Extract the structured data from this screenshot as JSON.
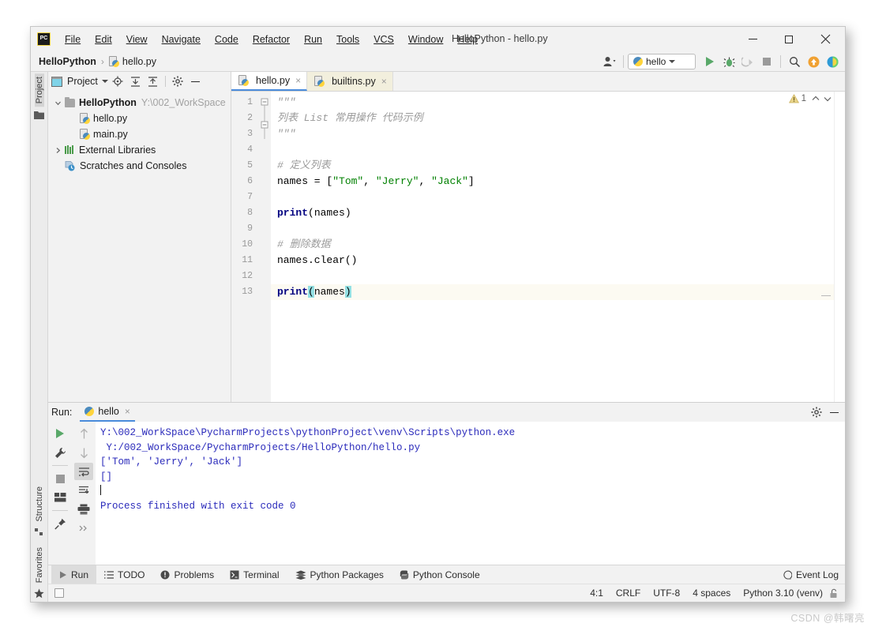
{
  "window": {
    "title": "HelloPython - hello.py",
    "logo_text": "PC",
    "min_label": "minimize",
    "max_label": "maximize",
    "close_label": "×"
  },
  "menubar": {
    "items": [
      "File",
      "Edit",
      "View",
      "Navigate",
      "Code",
      "Refactor",
      "Run",
      "Tools",
      "VCS",
      "Window",
      "Help"
    ]
  },
  "navbar": {
    "project": "HelloPython",
    "separator": "›",
    "file": "hello.py",
    "run_config": "hello",
    "icons": [
      "user-avatar-icon",
      "run-icon",
      "debug-icon",
      "coverage-icon",
      "stop-icon",
      "search-icon",
      "update-icon",
      "ai-icon"
    ]
  },
  "left_stripe": {
    "top": "Project",
    "bottom": [
      "Structure",
      "Favorites"
    ]
  },
  "project_panel": {
    "title": "Project",
    "toolbar_icons": [
      "locate-icon",
      "expand-all-icon",
      "collapse-all-icon",
      "settings-icon",
      "hide-icon"
    ],
    "tree": [
      {
        "label": "HelloPython",
        "path": "Y:\\002_WorkSpace",
        "depth": 0,
        "arrow": "⌄",
        "icon": "folder-icon",
        "bold": true
      },
      {
        "label": "hello.py",
        "path": "",
        "depth": 1,
        "arrow": "",
        "icon": "python-file-icon",
        "bold": false
      },
      {
        "label": "main.py",
        "path": "",
        "depth": 1,
        "arrow": "",
        "icon": "python-file-icon",
        "bold": false
      },
      {
        "label": "External Libraries",
        "path": "",
        "depth": 0,
        "arrow": "›",
        "icon": "library-icon",
        "bold": false
      },
      {
        "label": "Scratches and Consoles",
        "path": "",
        "depth": 0,
        "arrow": "",
        "icon": "scratches-icon",
        "bold": false
      }
    ]
  },
  "editor": {
    "tabs": [
      {
        "label": "hello.py",
        "active": true,
        "modified": false
      },
      {
        "label": "builtins.py",
        "active": false,
        "modified": false
      }
    ],
    "warning_count": "1",
    "lines": [
      {
        "n": "1",
        "segments": [
          {
            "t": "\"\"\"",
            "c": "doc"
          }
        ]
      },
      {
        "n": "2",
        "segments": [
          {
            "t": "列表 List 常用操作 代码示例",
            "c": "doc"
          }
        ]
      },
      {
        "n": "3",
        "segments": [
          {
            "t": "\"\"\"",
            "c": "doc"
          }
        ]
      },
      {
        "n": "4",
        "segments": []
      },
      {
        "n": "5",
        "segments": [
          {
            "t": "# 定义列表",
            "c": "com"
          }
        ]
      },
      {
        "n": "6",
        "segments": [
          {
            "t": "names = [",
            "c": "def"
          },
          {
            "t": "\"Tom\"",
            "c": "str"
          },
          {
            "t": ", ",
            "c": "def"
          },
          {
            "t": "\"Jerry\"",
            "c": "str"
          },
          {
            "t": ", ",
            "c": "def"
          },
          {
            "t": "\"Jack\"",
            "c": "str"
          },
          {
            "t": "]",
            "c": "def"
          }
        ]
      },
      {
        "n": "7",
        "segments": []
      },
      {
        "n": "8",
        "segments": [
          {
            "t": "print",
            "c": "kw"
          },
          {
            "t": "(names)",
            "c": "def"
          }
        ]
      },
      {
        "n": "9",
        "segments": []
      },
      {
        "n": "10",
        "segments": [
          {
            "t": "# 删除数据",
            "c": "com"
          }
        ]
      },
      {
        "n": "11",
        "segments": [
          {
            "t": "names.clear()",
            "c": "def"
          }
        ]
      },
      {
        "n": "12",
        "segments": []
      },
      {
        "n": "13",
        "segments": [
          {
            "t": "print",
            "c": "kw"
          },
          {
            "t": "(",
            "c": "brace"
          },
          {
            "t": "names",
            "c": "def"
          },
          {
            "t": ")",
            "c": "brace"
          }
        ]
      }
    ]
  },
  "run_panel": {
    "label": "Run:",
    "tab": "hello",
    "tools_left": [
      "rerun-icon",
      "settings-wrench-icon",
      "stop-icon",
      "layout-icon",
      "pin-icon"
    ],
    "tools_right": [
      "up-arrow-icon",
      "down-arrow-icon",
      "soft-wrap-icon",
      "scroll-to-end-icon",
      "print-icon",
      "more-icon"
    ],
    "header_icons": [
      "gear-icon",
      "minimize-icon"
    ],
    "console": [
      "Y:\\002_WorkSpace\\PycharmProjects\\pythonProject\\venv\\Scripts\\python.exe",
      " Y:/002_WorkSpace/PycharmProjects/HelloPython/hello.py",
      "['Tom', 'Jerry', 'Jack']",
      "[]",
      "",
      "Process finished with exit code 0"
    ]
  },
  "tool_window_bar": {
    "items": [
      {
        "label": "Run",
        "icon": "run-icon",
        "selected": true
      },
      {
        "label": "TODO",
        "icon": "todo-icon",
        "selected": false
      },
      {
        "label": "Problems",
        "icon": "problems-icon",
        "selected": false
      },
      {
        "label": "Terminal",
        "icon": "terminal-icon",
        "selected": false
      },
      {
        "label": "Python Packages",
        "icon": "packages-icon",
        "selected": false
      },
      {
        "label": "Python Console",
        "icon": "python-console-icon",
        "selected": false
      }
    ],
    "event_log": "Event Log"
  },
  "status_bar": {
    "caret": "4:1",
    "line_sep": "CRLF",
    "encoding": "UTF-8",
    "indent": "4 spaces",
    "interpreter": "Python 3.10 (venv)",
    "lock_icon": "lock-icon"
  },
  "watermark": "CSDN @韩曙亮",
  "colors": {
    "accent_blue": "#4a8bdb",
    "run_green": "#59a869",
    "string_green": "#008000",
    "keyword_navy": "#000080",
    "comment_gray": "#9b9b9b",
    "console_blue": "#2b2bbb",
    "brace_highlight": "#93e0e3",
    "current_line": "#fcfaf2"
  }
}
